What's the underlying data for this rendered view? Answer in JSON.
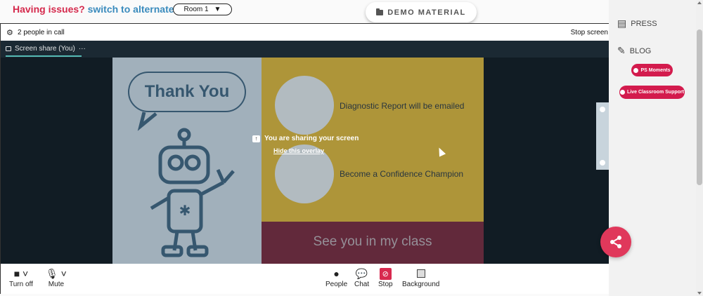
{
  "topbar": {
    "issues_text": "Having issues?",
    "alternate_link": "switch to alternate room",
    "room_select_value": "Room 1",
    "room_select_arrow": "▼",
    "demo_material_label": "DEMO MATERIAL"
  },
  "call": {
    "people_count": "2 people in call",
    "stop_screen": "Stop screen",
    "screen_share_tab": "Screen share (You)",
    "tab_menu": "···"
  },
  "slide": {
    "thank_you": "Thank You",
    "line1": "Diagnostic Report will be emailed",
    "line2": "Become a Confidence Champion",
    "footer": "See you in my class"
  },
  "overlay": {
    "sharing_text": "You are sharing your screen",
    "hide_link": "Hide this overlay"
  },
  "controls": {
    "turn_off": "Turn off",
    "mute": "Mute",
    "people": "People",
    "chat": "Chat",
    "stop": "Stop",
    "background": "Background"
  },
  "sidebar": {
    "press": "PRESS",
    "blog": "BLOG",
    "ps_moments": "PS Moments",
    "live_support": "Live Classroom Support"
  },
  "colors": {
    "accent_red": "#d5294c",
    "link_blue": "#3a8bbd",
    "tab_underline": "#5fd0c7",
    "slide_navy": "#3c5f79",
    "slide_mustard": "#c4a53c",
    "slide_maroon": "#6e2b3e"
  },
  "icons": {
    "settings": "gear-icon",
    "camera": "camera-icon",
    "mic": "microphone-icon",
    "people": "people-icon",
    "chat": "chat-icon",
    "stop": "stop-share-icon",
    "background": "background-icon",
    "press": "newspaper-icon",
    "blog": "pencil-icon",
    "share": "share-icon",
    "folder": "folder-icon"
  }
}
